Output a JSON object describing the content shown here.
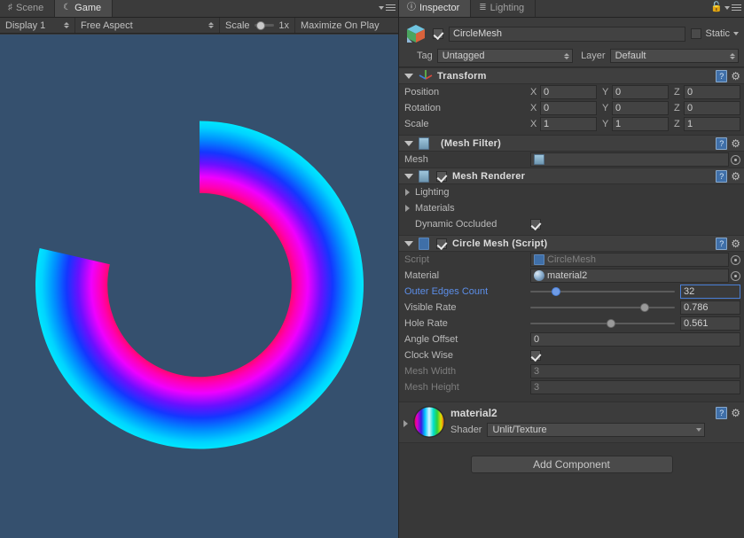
{
  "game_panel": {
    "tabs": [
      {
        "label": "Scene",
        "icon": "grid-icon",
        "active": false
      },
      {
        "label": "Game",
        "icon": "gamepad-icon",
        "active": true
      }
    ],
    "toolbar": {
      "display": "Display 1",
      "aspect": "Free Aspect",
      "scale_label": "Scale",
      "scale_value": "1x",
      "scale_position_pct": 6,
      "maximize": "Maximize On Play"
    },
    "canvas": {
      "background_color": "#35506e",
      "mesh": {
        "name": "circle-ring-mesh",
        "inner_color": "#ff1060",
        "mid_color": "#ff00e0",
        "blue_color": "#1030ff",
        "outer_color": "#00dcff",
        "visible_rate": 0.786,
        "hole_rate": 0.561,
        "angle_offset": 0,
        "clockwise": true
      }
    }
  },
  "inspector": {
    "tabs": [
      {
        "label": "Inspector",
        "icon": "info-icon",
        "active": true
      },
      {
        "label": "Lighting",
        "icon": "sliders-icon",
        "active": false
      }
    ],
    "lock_icon": "lock-icon",
    "menu_icon": "hamburger-icon",
    "object": {
      "icon": "prefab-cube-icon",
      "enabled": true,
      "name": "CircleMesh",
      "static_label": "Static",
      "static_checked": false,
      "tag_label": "Tag",
      "tag_value": "Untagged",
      "layer_label": "Layer",
      "layer_value": "Default"
    },
    "components": [
      {
        "title": "Transform",
        "icon": "transform-axis-icon",
        "expanded": true,
        "has_checkbox": false,
        "rows": [
          {
            "label": "Position",
            "x": "0",
            "y": "0",
            "z": "0"
          },
          {
            "label": "Rotation",
            "x": "0",
            "y": "0",
            "z": "0"
          },
          {
            "label": "Scale",
            "x": "1",
            "y": "1",
            "z": "1"
          }
        ]
      },
      {
        "title": "(Mesh Filter)",
        "icon": "mesh-filter-icon",
        "expanded": true,
        "has_checkbox": false,
        "mesh_label": "Mesh",
        "mesh_value": ""
      },
      {
        "title": "Mesh Renderer",
        "icon": "mesh-renderer-icon",
        "expanded": true,
        "has_checkbox": true,
        "checked": true,
        "sub_lighting": "Lighting",
        "sub_materials": "Materials",
        "dynamic_occluded_label": "Dynamic Occluded",
        "dynamic_occluded_checked": true
      },
      {
        "title": "Circle Mesh (Script)",
        "icon": "csharp-script-icon",
        "expanded": true,
        "has_checkbox": true,
        "checked": true,
        "fields": {
          "script_label": "Script",
          "script_value": "CircleMesh",
          "material_label": "Material",
          "material_value": "material2",
          "outer_edges_label": "Outer Edges Count",
          "outer_edges_value": "32",
          "outer_edges_slider_pct": 18,
          "visible_rate_label": "Visible Rate",
          "visible_rate_value": "0.786",
          "visible_rate_slider_pct": 79,
          "hole_rate_label": "Hole Rate",
          "hole_rate_value": "0.561",
          "hole_rate_slider_pct": 56,
          "angle_offset_label": "Angle Offset",
          "angle_offset_value": "0",
          "clock_wise_label": "Clock Wise",
          "clock_wise_checked": true,
          "mesh_width_label": "Mesh Width",
          "mesh_width_value": "3",
          "mesh_height_label": "Mesh Height",
          "mesh_height_value": "3"
        }
      }
    ],
    "material_block": {
      "preview_icon": "material-sphere-preview",
      "name": "material2",
      "shader_label": "Shader",
      "shader_value": "Unlit/Texture"
    },
    "add_component_label": "Add Component"
  },
  "colors": {
    "panel_bg": "#383838",
    "header_bg": "#3f3f3f",
    "tab_active": "#4b4b4b",
    "field_bg": "#434343",
    "accent_blue": "#5c8ee8",
    "game_bg": "#35506e"
  }
}
